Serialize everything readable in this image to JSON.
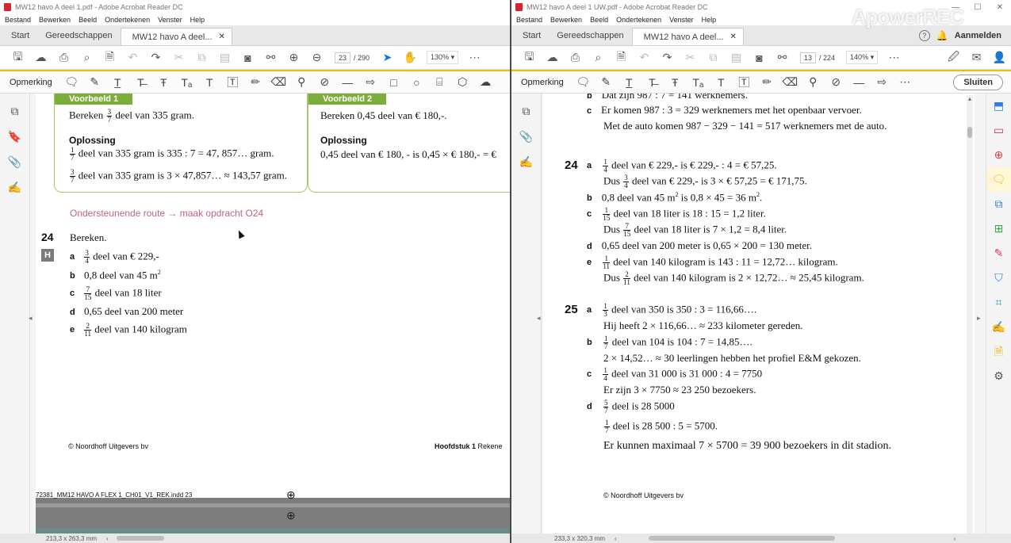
{
  "left": {
    "title": "MW12 havo A deel 1.pdf - Adobe Acrobat Reader DC",
    "menu": [
      "Bestand",
      "Bewerken",
      "Beeld",
      "Ondertekenen",
      "Venster",
      "Help"
    ],
    "tabs": {
      "start": "Start",
      "tools": "Gereedschappen",
      "doc": "MW12 havo A deel..."
    },
    "page_current": "23",
    "page_total": "/ 290",
    "zoom": "130%",
    "comment_label": "Opmerking",
    "status": "213,3 x 263,3 mm",
    "content": {
      "vb1_head": "Voorbeeld 1",
      "vb1_q_pre": "Bereken",
      "vb1_q_n": "3",
      "vb1_q_d": "7",
      "vb1_q_post": "deel van 335 gram.",
      "vb1_opl": "Oplossing",
      "vb1_l1_n": "1",
      "vb1_l1_d": "7",
      "vb1_l1": "deel van 335 gram is 335 : 7 = 47, 857… gram.",
      "vb1_l2_n": "3",
      "vb1_l2_d": "7",
      "vb1_l2": "deel van 335 gram is 3 × 47,857… ≈ 143,57 gram.",
      "vb2_head": "Voorbeeld 2",
      "vb2_q": "Bereken 0,45 deel van € 180,-.",
      "vb2_opl": "Oplossing",
      "vb2_l1": "0,45 deel van € 180, - is 0,45 × € 180,- = €",
      "route": "Ondersteunende route → maak opdracht O24",
      "q_num": "24",
      "q_title": "Bereken.",
      "q_h": "H",
      "qa_l": "a",
      "qa_n": "3",
      "qa_d": "4",
      "qa_t": "deel van € 229,-",
      "qb_l": "b",
      "qb_t": "0,8 deel van 45 m",
      "qb_sup": "2",
      "qc_l": "c",
      "qc_n": "7",
      "qc_d": "15",
      "qc_t": "deel van 18 liter",
      "qd_l": "d",
      "qd_t": "0,65 deel van 200 meter",
      "qe_l": "e",
      "qe_n": "2",
      "qe_d": "11",
      "qe_t": "deel van 140 kilogram",
      "footer_l": "© Noordhoff Uitgevers bv",
      "footer_r_b": "Hoofdstuk 1",
      "footer_r": "Rekene",
      "slug": "72381_MM12 HAVO A FLEX 1_CH01_V1_REK.indd   23"
    }
  },
  "right": {
    "title": "MW12 havo A deel 1 UW.pdf - Adobe Acrobat Reader DC",
    "menu": [
      "Bestand",
      "Bewerken",
      "Beeld",
      "Ondertekenen",
      "Venster",
      "Help"
    ],
    "tabs": {
      "start": "Start",
      "tools": "Gereedschappen",
      "doc": "MW12 havo A deel..."
    },
    "help": "?",
    "signin": "Aanmelden",
    "page_current": "13",
    "page_total": "/ 224",
    "zoom": "140%",
    "comment_label": "Opmerking",
    "close": "Sluiten",
    "status": "233,3 x 320,3 mm",
    "content": {
      "top_b": "b",
      "top_b_t": "Dat zijn 987 : 7 = 141 werknemers.",
      "top_c": "c",
      "top_c_t": "Er komen 987 : 3 = 329 werknemers met het openbaar vervoer.",
      "top_c2": "Met de auto komen 987 − 329 − 141 = 517 werknemers met de auto.",
      "n24": "24",
      "a24_l": "a",
      "a24_n": "1",
      "a24_d": "4",
      "a24_t": "deel van € 229,- is € 229,-  :  4 = € 57,25.",
      "a24_2pre": "Dus",
      "a24_2n": "3",
      "a24_2d": "4",
      "a24_2t": "deel van € 229,- is 3 × € 57,25 = € 171,75.",
      "b24_l": "b",
      "b24_t1": "0,8 deel van 45 m",
      "b24_sup1": "2",
      "b24_t2": "is 0,8 × 45 = 36 m",
      "b24_sup2": "2",
      "b24_t3": ".",
      "c24_l": "c",
      "c24_n": "1",
      "c24_d": "15",
      "c24_t": "deel van 18 liter is 18 : 15 = 1,2 liter.",
      "c24_2pre": "Dus",
      "c24_2n": "7",
      "c24_2d": "15",
      "c24_2t": "deel van 18 liter is 7 × 1,2 = 8,4 liter.",
      "d24_l": "d",
      "d24_t": "0,65 deel van 200 meter is 0,65 × 200 = 130 meter.",
      "e24_l": "e",
      "e24_n": "1",
      "e24_d": "11",
      "e24_t": "deel van 140 kilogram is 143 : 11 = 12,72… kilogram.",
      "e24_2pre": "Dus",
      "e24_2n": "2",
      "e24_2d": "11",
      "e24_2t": "deel van 140 kilogram is 2 × 12,72… ≈ 25,45 kilogram.",
      "n25": "25",
      "a25_l": "a",
      "a25_n": "1",
      "a25_d": "3",
      "a25_t": "deel van 350 is 350 : 3 = 116,66….",
      "a25_2": "Hij heeft 2 × 116,66… ≈ 233 kilometer gereden.",
      "b25_l": "b",
      "b25_n": "1",
      "b25_d": "7",
      "b25_t": "deel van 104 is 104 : 7 = 14,85….",
      "b25_2": "2 × 14,52… ≈ 30 leerlingen hebben het profiel E&M gekozen.",
      "c25_l": "c",
      "c25_n": "1",
      "c25_d": "4",
      "c25_t": "deel van 31 000 is 31 000 : 4 = 7750",
      "c25_2": "Er zijn 3 × 7750 ≈ 23 250 bezoekers.",
      "d25_l": "d",
      "d25_n": "5",
      "d25_d": "7",
      "d25_t": "deel is 28 5000",
      "d25_2n": "1",
      "d25_2d": "7",
      "d25_2t": "deel is 28 500 : 5 = 5700.",
      "d25_3": "Er kunnen maximaal 7 × 5700 = 39 900 bezoekers in dit stadion.",
      "footer": "© Noordhoff Uitgevers bv"
    }
  },
  "watermark": "ApowerREC"
}
